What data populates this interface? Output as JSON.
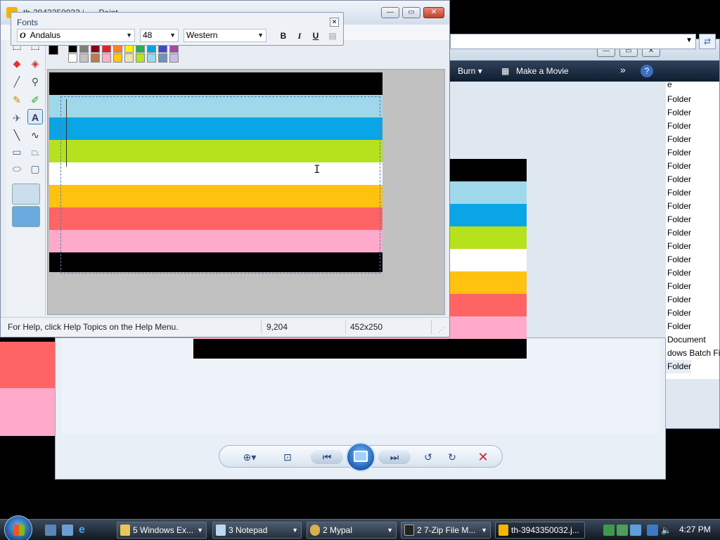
{
  "colors": {
    "black": "#000000",
    "light_blue": "#9fd8ea",
    "blue": "#0aa5e6",
    "green": "#b6e21d",
    "white": "#ffffff",
    "orange": "#ffc20f",
    "red": "#ff6464",
    "pink": "#ffaacb"
  },
  "paint": {
    "title": "th-3943350032.j... - Paint",
    "status_help": "For Help, click Help Topics on the Help Menu.",
    "status_coords": "9,204",
    "status_size": "452x250",
    "tools": [
      "eraser-icon",
      "fill-bucket-icon",
      "eyedropper-icon",
      "magnifier-icon",
      "pencil-icon",
      "brush-icon",
      "airbrush-icon",
      "text-icon",
      "line-icon",
      "curve-icon",
      "rectangle-icon",
      "polygon-icon",
      "ellipse-icon",
      "rounded-rectangle-icon"
    ]
  },
  "fonts_toolbar": {
    "title": "Fonts",
    "font_name": "Andalus",
    "font_size": "48",
    "script": "Western",
    "bold": "B",
    "italic": "I",
    "underline": "U"
  },
  "explorer": {
    "burn": "Burn",
    "make_movie": "Make a Movie",
    "more": "»",
    "help": "?",
    "partial_header": "e",
    "rows": [
      "Folder",
      "Folder",
      "Folder",
      "Folder",
      "Folder",
      "Folder",
      "Folder",
      "Folder",
      "Folder",
      "Folder",
      "Folder",
      "Folder",
      "Folder",
      "Folder",
      "Folder",
      "Folder",
      "Folder",
      "Folder",
      "Document",
      "dows Batch File",
      "Folder"
    ]
  },
  "taskbar": {
    "items": [
      {
        "label": "5 Windows Ex...",
        "bold": "5"
      },
      {
        "label": "3 Notepad",
        "bold": "3"
      },
      {
        "label": "2 Mypal",
        "bold": "2"
      },
      {
        "label": "2 7-Zip File M...",
        "bold": "2"
      },
      {
        "label": "th-3943350032.j..."
      }
    ],
    "clock": "4:27 PM"
  }
}
